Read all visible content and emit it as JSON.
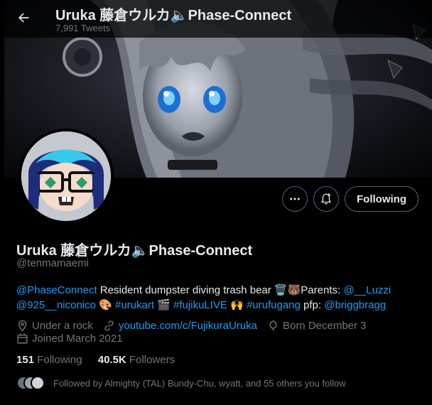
{
  "header": {
    "title": "Uruka 藤倉ウルカ🔈Phase-Connect",
    "tweet_count": "7,991 Tweets"
  },
  "profile": {
    "display_name": "Uruka 藤倉ウルカ🔈Phase-Connect",
    "handle": "@tenmamaemi",
    "follow_button": "Following",
    "bio": {
      "mention_phase": "@PhaseConnect",
      "text1": " Resident dumpster diving trash bear 🗑️🐻Parents: ",
      "mention_luzzi": "@__Luzzi",
      "mention_niconico": "@925__niconico",
      "text2": " 🎨 ",
      "tag_urukart": "#urukart",
      "text3": " 🎬 ",
      "tag_fujiku": "#fujikuLIVE",
      "text4": " 🙌 ",
      "tag_urufugang": "#urufugang",
      "text5": " pfp: ",
      "mention_brigg": "@briggbragg"
    },
    "location": "Under a rock",
    "website": "youtube.com/c/FujikuraUruka",
    "birthday": "Born December 3",
    "joined": "Joined March 2021",
    "following_count": "151",
    "following_label": " Following",
    "followers_count": "40.5K",
    "followers_label": " Followers",
    "followed_by": "Followed by Almighty (TAL) Bundy-Chu, wyatt, and 55 others you follow"
  },
  "colors": {
    "background": "#000000",
    "text": "#e7e9ea",
    "muted": "#71767b",
    "link": "#1d9bf0",
    "border": "#536471"
  },
  "icons": [
    "back-arrow-icon",
    "more-icon",
    "notification-bell-icon",
    "location-icon",
    "link-icon",
    "birthday-icon",
    "calendar-icon"
  ]
}
